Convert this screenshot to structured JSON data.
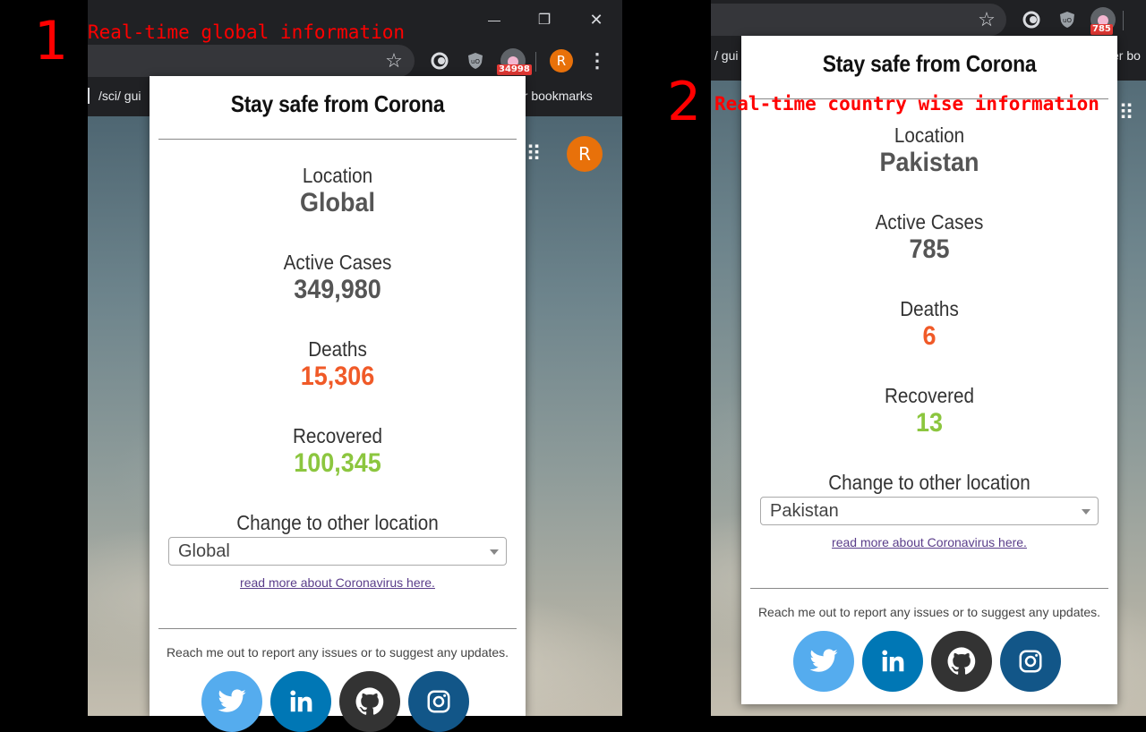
{
  "annotations": {
    "one": {
      "number": "1",
      "text": "Real-time global information"
    },
    "two": {
      "number": "2",
      "text": "Real-time country wise information"
    }
  },
  "browser1": {
    "bookmark_text": "/sci/ gui",
    "other_bookmarks": "er bookmarks",
    "badge": "34998",
    "avatar": "R",
    "page_avatar": "R"
  },
  "browser2": {
    "bookmark_text": "/ gui",
    "other_bookmarks": "er bo",
    "badge": "785"
  },
  "popup1": {
    "title": "Stay safe from Corona",
    "location_label": "Location",
    "location_value": "Global",
    "active_label": "Active Cases",
    "active_value": "349,980",
    "deaths_label": "Deaths",
    "deaths_value": "15,306",
    "recovered_label": "Recovered",
    "recovered_value": "100,345",
    "change_label": "Change to other location",
    "select_value": "Global",
    "read_more": "read more about Coronavirus here.",
    "report_text": "Reach me out to report any issues or to suggest any updates."
  },
  "popup2": {
    "title": "Stay safe from Corona",
    "location_label": "Location",
    "location_value": "Pakistan",
    "active_label": "Active Cases",
    "active_value": "785",
    "deaths_label": "Deaths",
    "deaths_value": "6",
    "recovered_label": "Recovered",
    "recovered_value": "13",
    "change_label": "Change to other location",
    "select_value": "Pakistan",
    "read_more": "read more about Coronavirus here.",
    "report_text": "Reach me out to report any issues or to suggest any updates."
  },
  "icons": {
    "star": "☆",
    "menu": "⋮",
    "apps": "⠿",
    "minimize": "—",
    "restore": "❐",
    "close": "✕"
  },
  "colors": {
    "deaths": "#f05a28",
    "recovered": "#8cc63f",
    "twitter": "#55acee",
    "linkedin": "#0077b5",
    "github": "#333333",
    "instagram": "#125688",
    "annotation": "#ff0000"
  }
}
